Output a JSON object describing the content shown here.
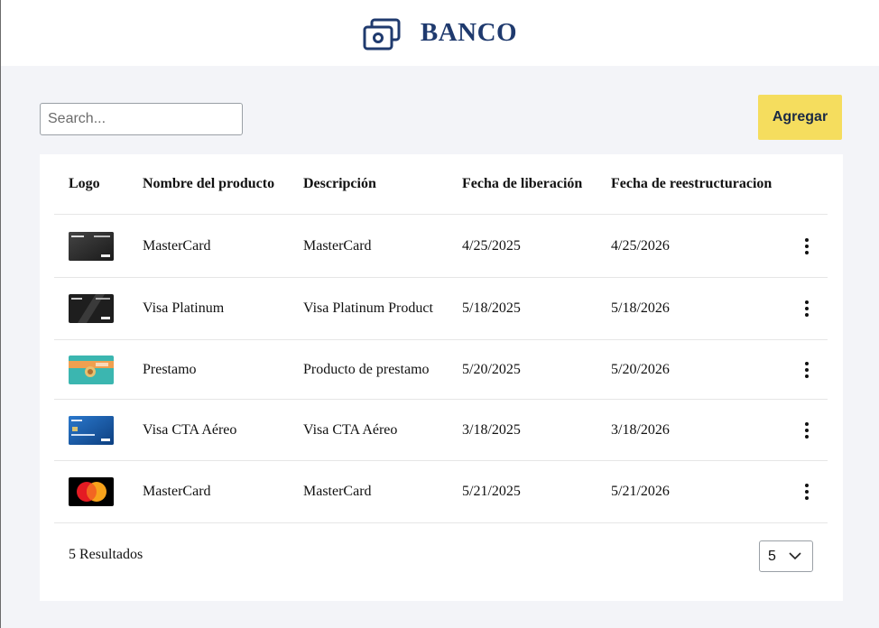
{
  "header": {
    "brand": "BANCO",
    "logo_icon": "banknote-icon"
  },
  "toolbar": {
    "search_placeholder": "Search...",
    "search_value": "",
    "add_label": "Agregar"
  },
  "table": {
    "columns": {
      "logo": "Logo",
      "name": "Nombre del producto",
      "description": "Descripción",
      "release": "Fecha de liberación",
      "restructure": "Fecha de reestructuracion"
    },
    "rows": [
      {
        "logo": "mastercard-black-card-thumbnail",
        "name": "MasterCard",
        "description": "MasterCard",
        "release": "4/25/2025",
        "restructure": "4/25/2026"
      },
      {
        "logo": "visa-platinum-card-thumbnail",
        "name": "Visa Platinum",
        "description": "Visa Platinum Product",
        "release": "5/18/2025",
        "restructure": "5/18/2026"
      },
      {
        "logo": "loan-illustration-thumbnail",
        "name": "Prestamo",
        "description": "Producto de prestamo",
        "release": "5/20/2025",
        "restructure": "5/20/2026"
      },
      {
        "logo": "visa-cta-aereo-card-thumbnail",
        "name": "Visa CTA Aéreo",
        "description": "Visa CTA Aéreo",
        "release": "3/18/2025",
        "restructure": "3/18/2026"
      },
      {
        "logo": "mastercard-logo-thumbnail",
        "name": "MasterCard",
        "description": "MasterCard",
        "release": "5/21/2025",
        "restructure": "5/21/2026"
      }
    ]
  },
  "footer": {
    "results": "5 Resultados",
    "page_size": "5"
  },
  "colors": {
    "brand": "#1f3a6e",
    "accent_button": "#f5dd5e",
    "page_bg": "#f3f4f8"
  }
}
